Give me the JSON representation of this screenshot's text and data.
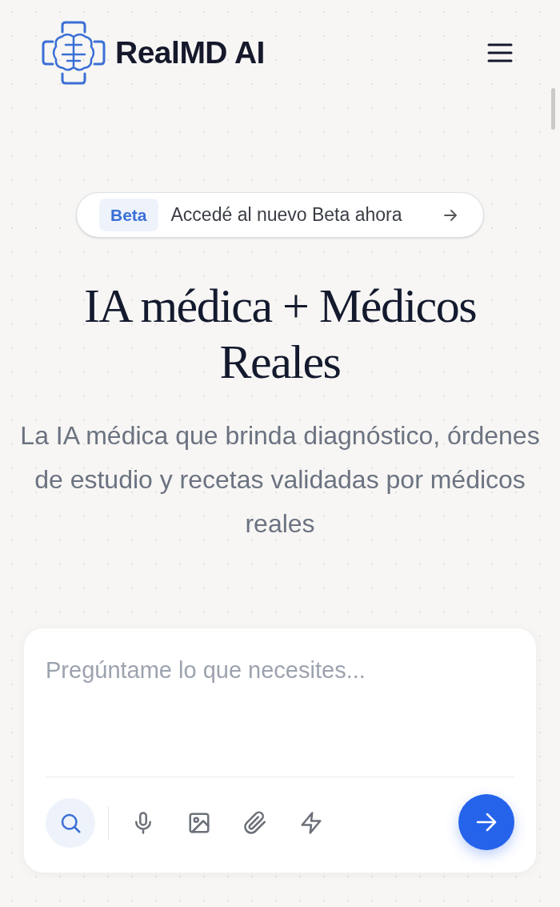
{
  "header": {
    "brand": "RealMD AI"
  },
  "announcement": {
    "badge": "Beta",
    "text": "Accedé al nuevo Beta ahora"
  },
  "hero": {
    "title_lines": [
      "IA médica + Médicos",
      "Reales"
    ],
    "subtitle": "La IA médica que brinda diagnóstico, órdenes de estudio y recetas validadas por médicos reales"
  },
  "chat": {
    "placeholder": "Pregúntame lo que necesites...",
    "tools": [
      {
        "kind": "search",
        "selected": true
      },
      {
        "kind": "mic",
        "selected": false
      },
      {
        "kind": "image",
        "selected": false
      },
      {
        "kind": "attach",
        "selected": false
      },
      {
        "kind": "bolt",
        "selected": false
      }
    ]
  }
}
